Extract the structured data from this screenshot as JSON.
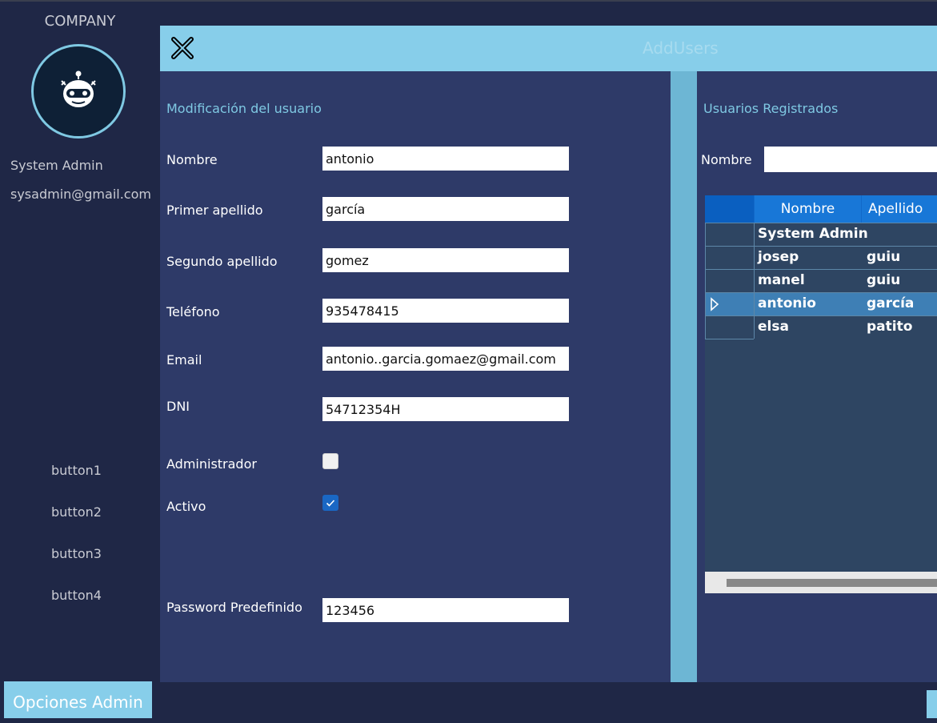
{
  "sidebar": {
    "company": "COMPANY",
    "user_name": "System Admin",
    "user_email": "sysadmin@gmail.com",
    "buttons": [
      "button1",
      "button2",
      "button3",
      "button4"
    ]
  },
  "bottom": {
    "admin_options": "Opciones Admin"
  },
  "header": {
    "title": "AddUsers"
  },
  "form": {
    "section_title": "Modificación del usuario",
    "fields": [
      {
        "label": "Nombre",
        "value": "antonio"
      },
      {
        "label": "Primer apellido",
        "value": "garcía"
      },
      {
        "label": "Segundo apellido",
        "value": "gomez"
      },
      {
        "label": "Teléfono",
        "value": "935478415"
      },
      {
        "label": "Email",
        "value": "antonio..garcia.gomaez@gmail.com"
      },
      {
        "label": "DNI",
        "value": "54712354H"
      }
    ],
    "admin": {
      "label": "Administrador",
      "checked": false
    },
    "active": {
      "label": "Activo",
      "checked": true
    },
    "password": {
      "label": "Password Predefinido",
      "value": "123456"
    }
  },
  "list": {
    "section_title": "Usuarios Registrados",
    "filter_label": "Nombre",
    "filter_value": "",
    "columns": [
      "Nombre",
      "Apellido"
    ],
    "rows": [
      {
        "nombre": "System Admin",
        "apellido": ""
      },
      {
        "nombre": "josep",
        "apellido": "guiu"
      },
      {
        "nombre": "manel",
        "apellido": "guiu"
      },
      {
        "nombre": "antonio",
        "apellido": "garcía"
      },
      {
        "nombre": "elsa",
        "apellido": "patito"
      }
    ],
    "selected_row": 3
  },
  "colors": {
    "accent": "#87ceea",
    "panel": "#2e3a68",
    "background": "#1f2746",
    "grid_header": "#1877d7",
    "selected_row": "#3e7fb5"
  }
}
